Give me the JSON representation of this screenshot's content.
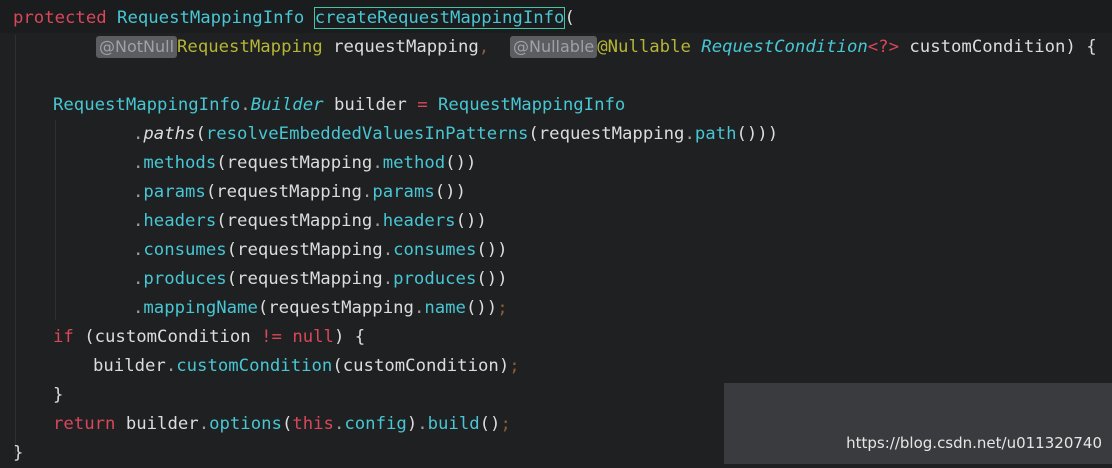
{
  "code": {
    "l1": {
      "kw": "protected",
      "type": "RequestMappingInfo",
      "method": "createRequestMappingInfo",
      "paren": "("
    },
    "l2": {
      "hint1": "@NotNull",
      "type": "RequestMapping",
      "param": "requestMapping",
      "comma": ",",
      "hint2": "@Nullable",
      "ann": "@Nullable",
      "type2": "RequestCondition",
      "generic": "<?>",
      "param2": "customCondition",
      "close": ") {"
    },
    "l4": {
      "type": "RequestMappingInfo",
      "builder": "Builder",
      "var": "builder",
      "eq": "=",
      "value": "RequestMappingInfo"
    },
    "l5": {
      "m": "paths",
      "open": "(",
      "call": "resolveEmbeddedValuesInPatterns",
      "arg": "requestMapping",
      "prop": "path",
      "close": "()))"
    },
    "l6": {
      "m": "methods",
      "arg": "requestMapping",
      "prop": "method",
      "close": "())"
    },
    "l7": {
      "m": "params",
      "arg": "requestMapping",
      "prop": "params",
      "close": "())"
    },
    "l8": {
      "m": "headers",
      "arg": "requestMapping",
      "prop": "headers",
      "close": "())"
    },
    "l9": {
      "m": "consumes",
      "arg": "requestMapping",
      "prop": "consumes",
      "close": "())"
    },
    "l10": {
      "m": "produces",
      "arg": "requestMapping",
      "prop": "produces",
      "close": "())"
    },
    "l11": {
      "m": "mappingName",
      "arg": "requestMapping",
      "prop": "name",
      "close": "())",
      "semi": ";"
    },
    "l12": {
      "kw": "if",
      "open": "(",
      "var": "customCondition",
      "op": "!=",
      "null": "null",
      "close": ") {"
    },
    "l13": {
      "var": "builder",
      "m": "customCondition",
      "arg": "customCondition",
      "close": ")",
      "semi": ";"
    },
    "l14": {
      "brace": "}"
    },
    "l15": {
      "kw": "return",
      "var": "builder",
      "m": "options",
      "this": "this",
      "prop": "config",
      "m2": "build",
      "close2": "()",
      "semi": ";"
    },
    "l16": {
      "brace": "}"
    }
  },
  "watermark": "https://blog.csdn.net/u011320740"
}
